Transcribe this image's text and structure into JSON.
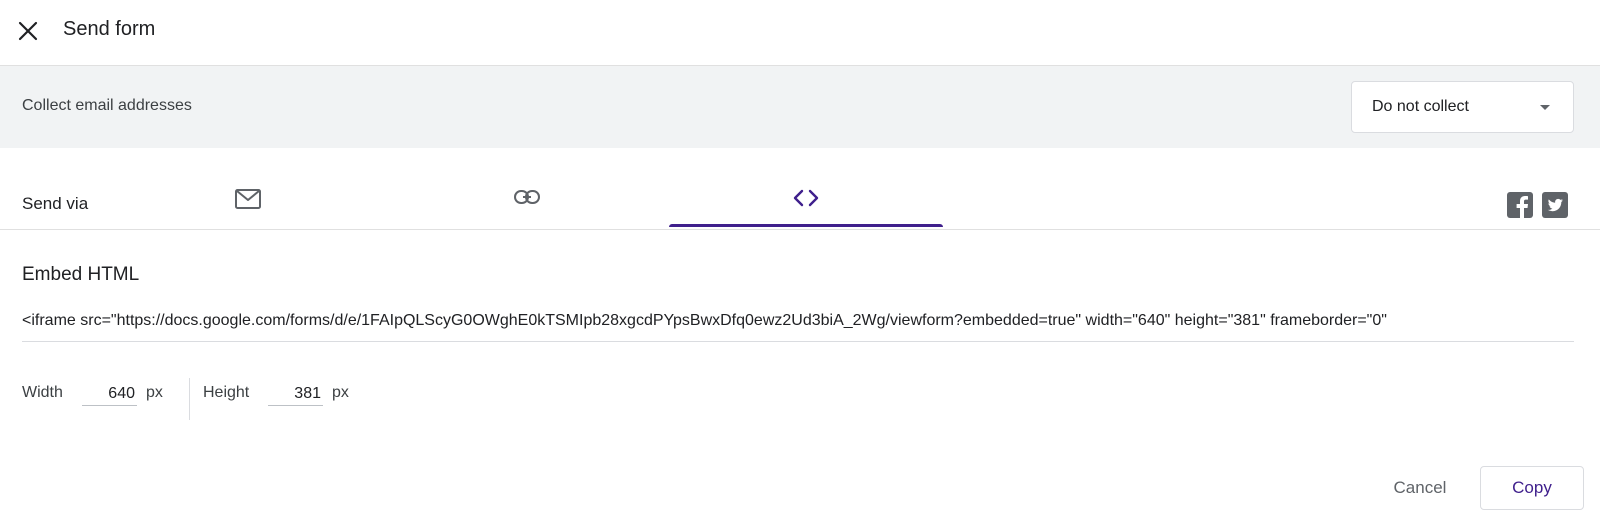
{
  "header": {
    "title": "Send form",
    "close_icon": "close-icon"
  },
  "collect": {
    "label": "Collect email addresses",
    "selected": "Do not collect"
  },
  "send_via": {
    "label": "Send via",
    "tabs": [
      {
        "name": "email",
        "icon": "mail-icon"
      },
      {
        "name": "link",
        "icon": "link-icon"
      },
      {
        "name": "embed",
        "icon": "code-icon",
        "active": true
      }
    ],
    "accent": "#3f1f8c",
    "social": [
      "facebook-icon",
      "twitter-icon"
    ]
  },
  "embed": {
    "title": "Embed HTML",
    "code": "<iframe src=\"https://docs.google.com/forms/d/e/1FAIpQLScyG0OWghE0kTSMIpb28xgcdPYpsBwxDfq0ewz2Ud3biA_2Wg/viewform?embedded=true\" width=\"640\" height=\"381\" frameborder=\"0\"",
    "width_label": "Width",
    "width_value": "640",
    "height_label": "Height",
    "height_value": "381",
    "unit": "px"
  },
  "actions": {
    "cancel": "Cancel",
    "copy": "Copy"
  }
}
